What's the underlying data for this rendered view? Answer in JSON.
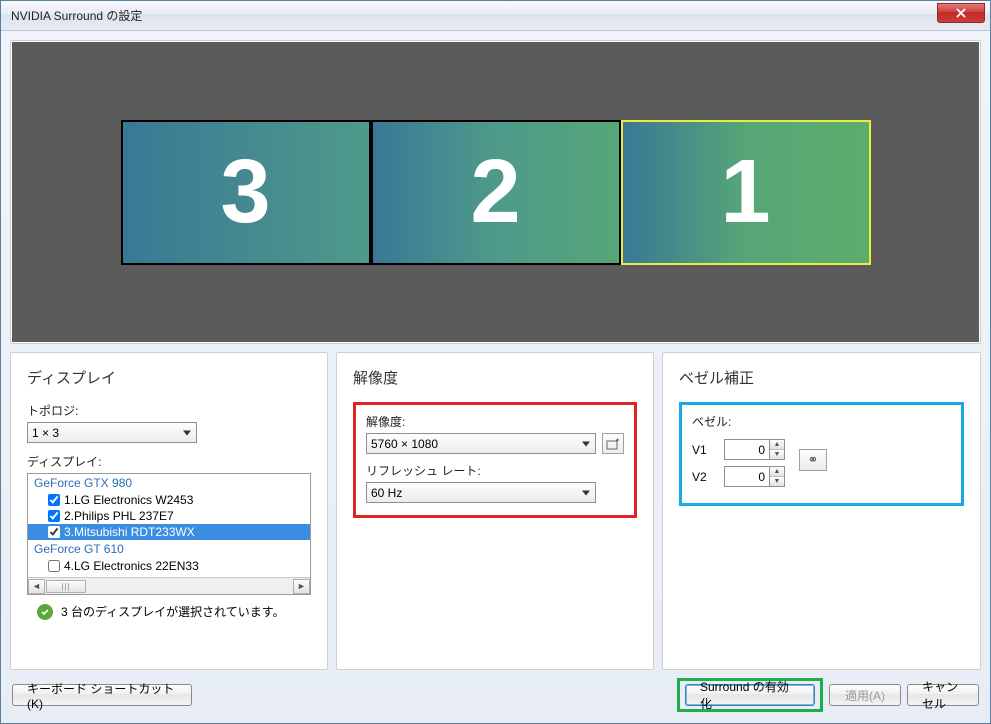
{
  "window": {
    "title": "NVIDIA Surround の設定"
  },
  "monitors": [
    "3",
    "2",
    "1"
  ],
  "display_panel": {
    "title": "ディスプレイ",
    "topology_label": "トポロジ:",
    "topology_value": "1 × 3",
    "displays_label": "ディスプレイ:",
    "gpu0": "GeForce GTX 980",
    "items": [
      {
        "label": "1.LG Electronics W2453",
        "checked": true,
        "selected": false
      },
      {
        "label": "2.Philips PHL 237E7",
        "checked": true,
        "selected": false
      },
      {
        "label": "3.Mitsubishi RDT233WX",
        "checked": true,
        "selected": true
      }
    ],
    "gpu1": "GeForce GT 610",
    "item_gpu1": {
      "label": "4.LG Electronics 22EN33",
      "checked": false
    },
    "status": "3 台のディスプレイが選択されています。"
  },
  "resolution_panel": {
    "title": "解像度",
    "resolution_label": "解像度:",
    "resolution_value": "5760 × 1080",
    "refresh_label": "リフレッシュ レート:",
    "refresh_value": "60  Hz"
  },
  "bezel_panel": {
    "title": "ベゼル補正",
    "bezel_label": "ベゼル:",
    "v1_label": "V1",
    "v1_value": "0",
    "v2_label": "V2",
    "v2_value": "0"
  },
  "buttons": {
    "keyboard_shortcuts": "キーボード ショートカット(K)",
    "enable_surround": "Surround の有効化",
    "apply": "適用(A)",
    "cancel": "キャンセル"
  }
}
